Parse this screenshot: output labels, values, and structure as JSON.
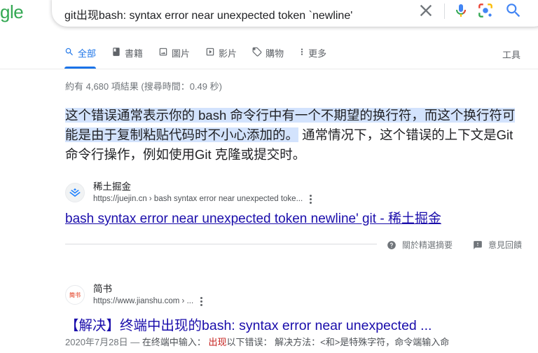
{
  "logo_text": "gle",
  "search": {
    "query": "git出现bash: syntax error near unexpected token `newline'"
  },
  "tabs": [
    {
      "label": "全部",
      "icon": "search-icon"
    },
    {
      "label": "書籍",
      "icon": "book-icon"
    },
    {
      "label": "圖片",
      "icon": "image-icon"
    },
    {
      "label": "影片",
      "icon": "video-icon"
    },
    {
      "label": "購物",
      "icon": "tag-icon"
    },
    {
      "label": "更多",
      "icon": "more-vert-icon"
    }
  ],
  "tools_label": "工具",
  "stats": "約有 4,680 項結果 (搜尋時間：0.49 秒)",
  "featured": {
    "highlighted": "这个错误通常表示你的 bash 命令行中有一个不期望的换行符，而这个换行符可能是由于复制粘贴代码时不小心添加的。",
    "rest": " 通常情况下，这个错误的上下文是Git 命令行操作，例如使用Git 克隆或提交时。",
    "source_name": "稀土掘金",
    "source_url": "https://juejin.cn › bash syntax error near unexpected toke...",
    "link": "bash syntax error near unexpected token newline' git - 稀土掘金",
    "about_label": "關於精選摘要",
    "feedback_label": "意見回饋"
  },
  "result2": {
    "favicon_text": "简书",
    "source_name": "简书",
    "source_url": "https://www.jianshu.com › ...",
    "title": "【解决】终端中出现的bash: syntax error near unexpected ...",
    "date": "2020年7月28日 —",
    "desc_a": " 在终端中输入： ",
    "desc_em": "出现",
    "desc_b": "以下错误： 解决方法：<和>是特殊字符，命令端输入命"
  },
  "colors": {
    "link": "#1a0dab",
    "active_tab": "#1a73e8",
    "highlight": "#d3e3fd"
  }
}
